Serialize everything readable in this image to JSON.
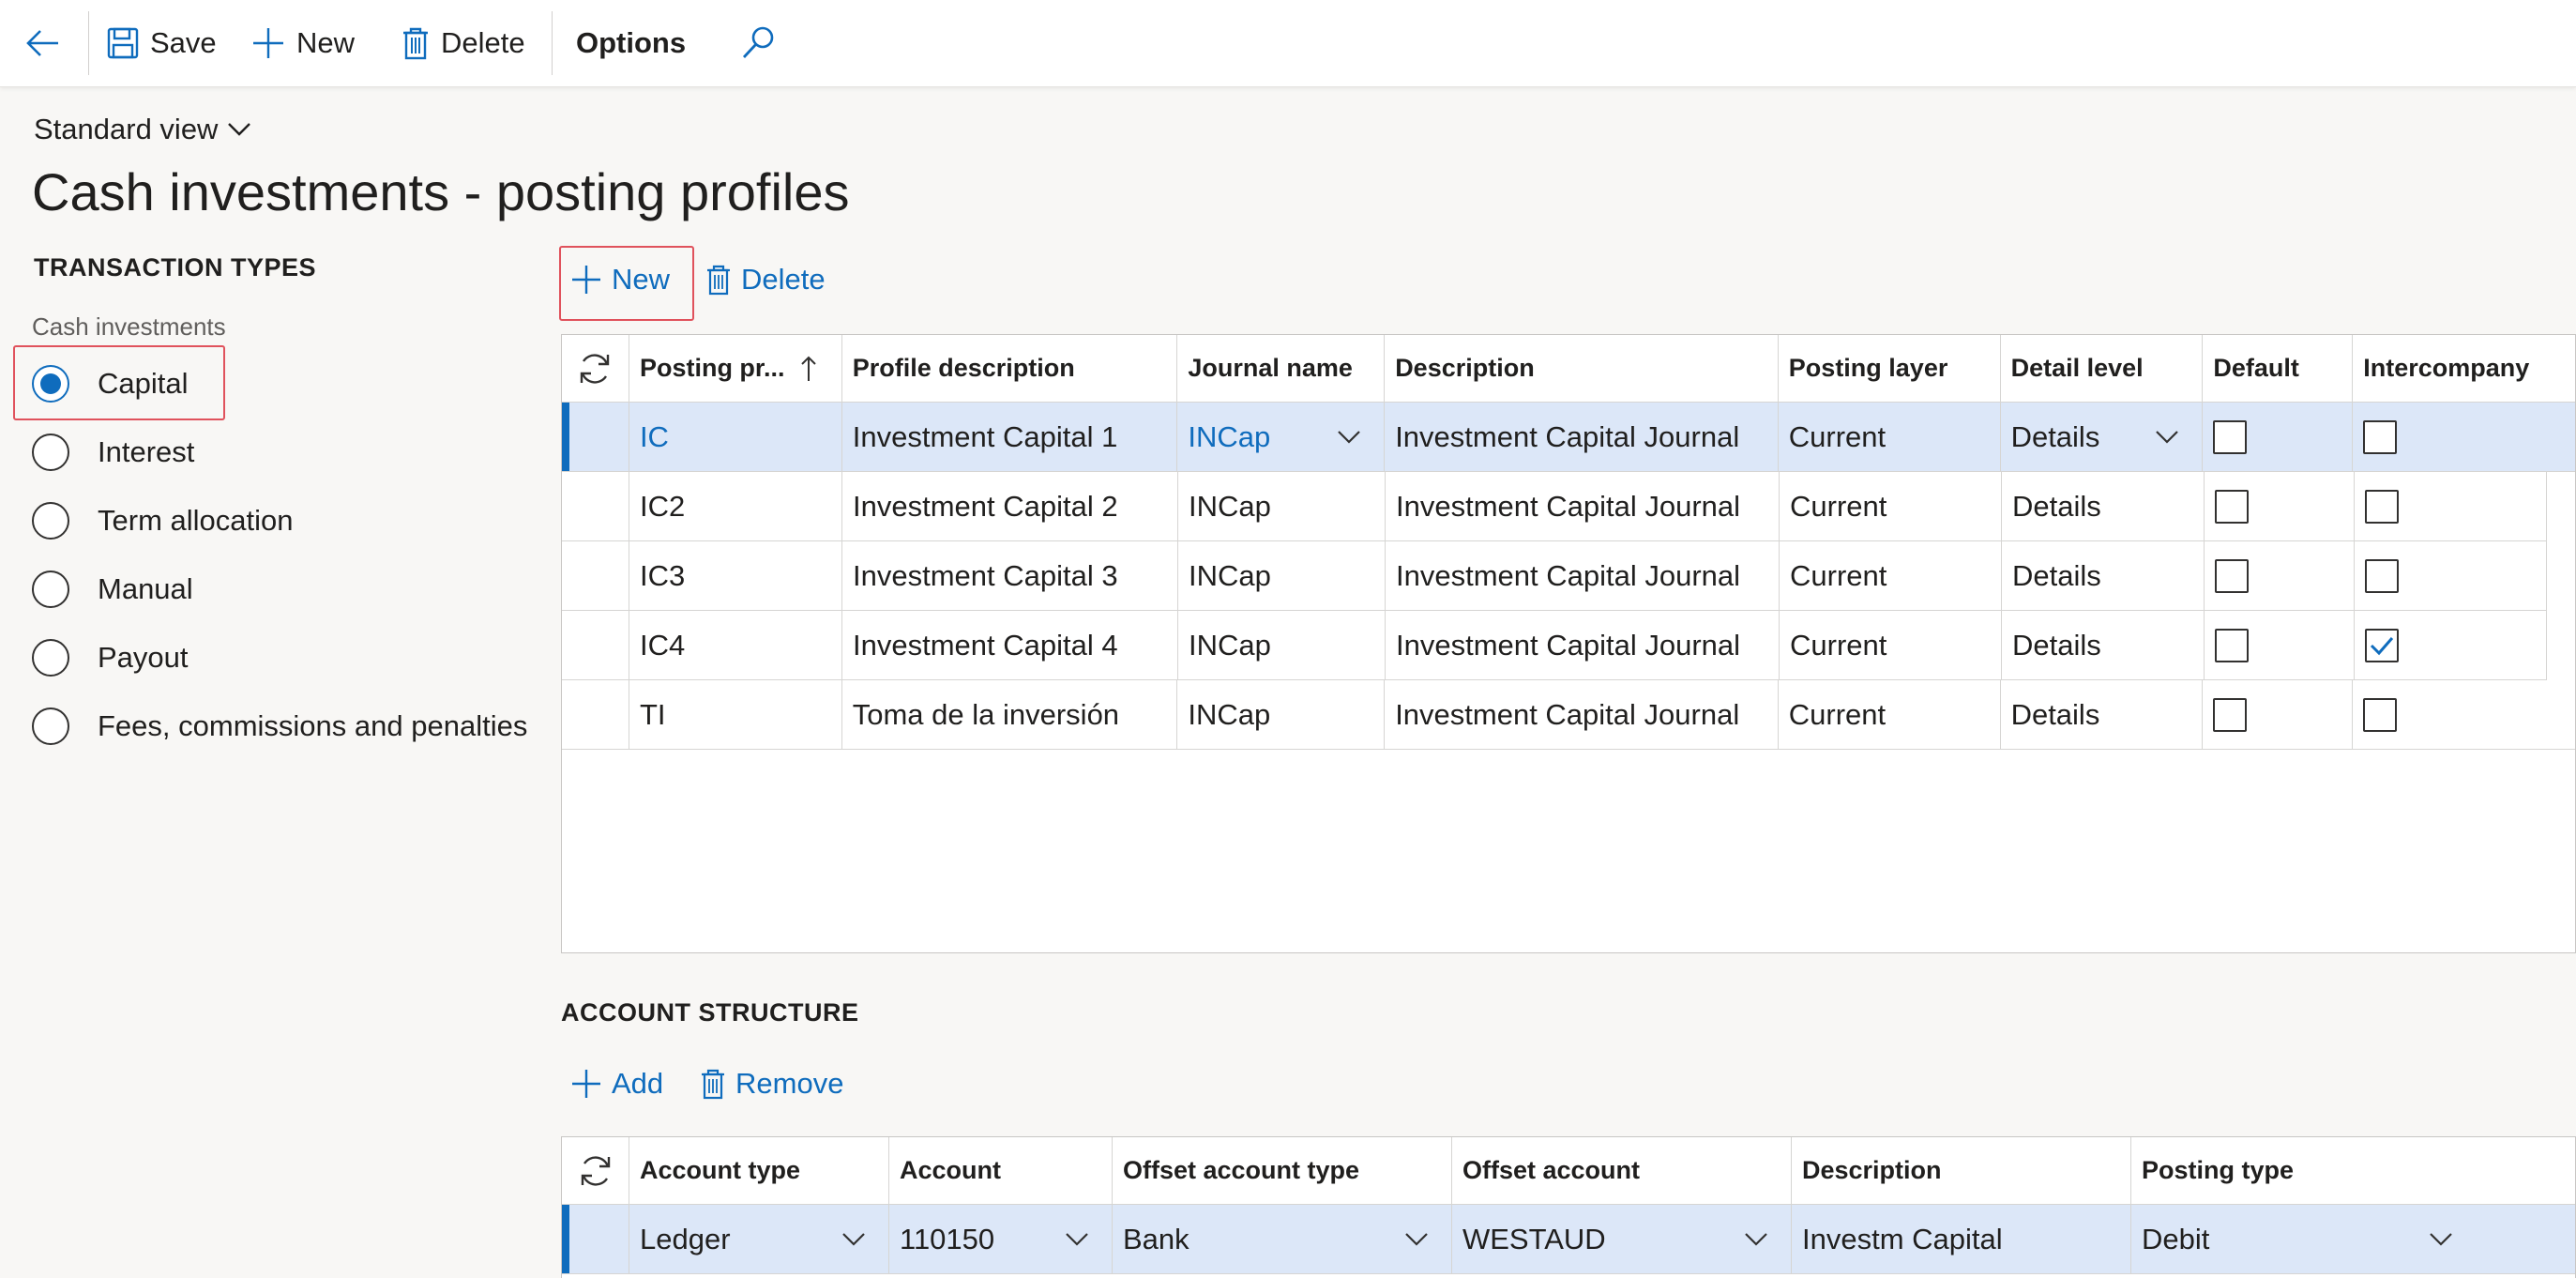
{
  "toolbar": {
    "save_label": "Save",
    "new_label": "New",
    "delete_label": "Delete",
    "options_label": "Options"
  },
  "view": {
    "label": "Standard view"
  },
  "page": {
    "title": "Cash investments - posting profiles"
  },
  "transaction_types": {
    "heading": "TRANSACTION TYPES",
    "group_label": "Cash investments",
    "options": [
      {
        "label": "Capital",
        "selected": true
      },
      {
        "label": "Interest",
        "selected": false
      },
      {
        "label": "Term allocation",
        "selected": false
      },
      {
        "label": "Manual",
        "selected": false
      },
      {
        "label": "Payout",
        "selected": false
      },
      {
        "label": "Fees, commissions and penalties",
        "selected": false
      }
    ]
  },
  "profiles_grid": {
    "new_label": "New",
    "delete_label": "Delete",
    "columns": [
      "Posting pr...",
      "Profile description",
      "Journal name",
      "Description",
      "Posting layer",
      "Detail level",
      "Default",
      "Intercompany"
    ],
    "rows": [
      {
        "posting_profile": "IC",
        "profile_description": "Investment Capital 1",
        "journal_name": "INCap",
        "description": "Investment Capital Journal",
        "posting_layer": "Current",
        "detail_level": "Details",
        "default": false,
        "intercompany": false
      },
      {
        "posting_profile": "IC2",
        "profile_description": "Investment Capital 2",
        "journal_name": "INCap",
        "description": "Investment Capital Journal",
        "posting_layer": "Current",
        "detail_level": "Details",
        "default": false,
        "intercompany": false
      },
      {
        "posting_profile": "IC3",
        "profile_description": "Investment Capital 3",
        "journal_name": "INCap",
        "description": "Investment Capital Journal",
        "posting_layer": "Current",
        "detail_level": "Details",
        "default": false,
        "intercompany": false
      },
      {
        "posting_profile": "IC4",
        "profile_description": "Investment Capital 4",
        "journal_name": "INCap",
        "description": "Investment Capital Journal",
        "posting_layer": "Current",
        "detail_level": "Details",
        "default": false,
        "intercompany": true
      },
      {
        "posting_profile": "TI",
        "profile_description": "Toma de la inversión",
        "journal_name": "INCap",
        "description": "Investment Capital Journal",
        "posting_layer": "Current",
        "detail_level": "Details",
        "default": false,
        "intercompany": false
      }
    ]
  },
  "account_structure": {
    "heading": "ACCOUNT STRUCTURE",
    "add_label": "Add",
    "remove_label": "Remove",
    "columns": [
      "Account type",
      "Account",
      "Offset account type",
      "Offset account",
      "Description",
      "Posting type"
    ],
    "rows": [
      {
        "account_type": "Ledger",
        "account": "110150",
        "offset_account_type": "Bank",
        "offset_account": "WESTAUD",
        "description": "Investm Capital",
        "posting_type": "Debit"
      }
    ]
  },
  "colors": {
    "accent": "#0f6cbd",
    "selected_row": "#dce7f8",
    "highlight_box": "#e0525c"
  }
}
